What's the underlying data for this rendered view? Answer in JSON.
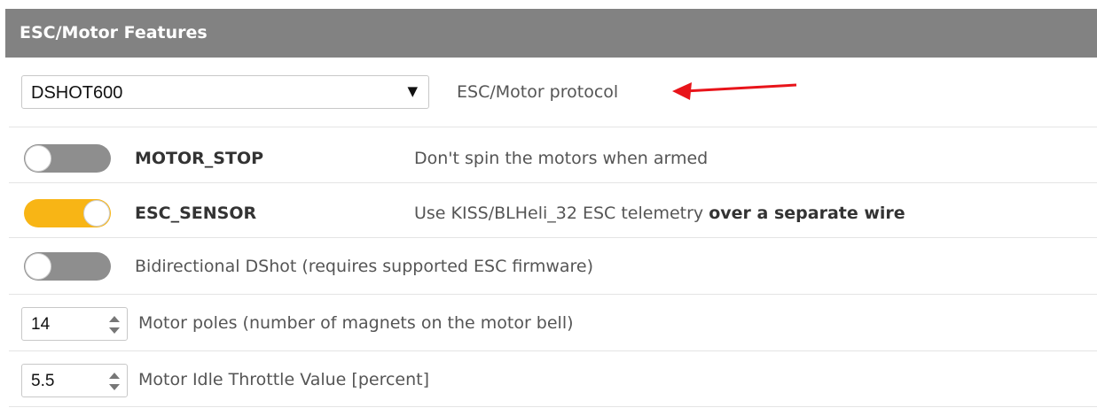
{
  "header": {
    "title": "ESC/Motor Features"
  },
  "protocol": {
    "selected": "DSHOT600",
    "arrow_glyph": "▼",
    "label": "ESC/Motor protocol"
  },
  "features": [
    {
      "name": "MOTOR_STOP",
      "enabled": false,
      "description": "Don't spin the motors when armed"
    },
    {
      "name": "ESC_SENSOR",
      "enabled": true,
      "description_pre": "Use KISS/BLHeli_32 ESC telemetry ",
      "description_bold": "over a separate wire"
    },
    {
      "enabled": false,
      "description": "Bidirectional DShot (requires supported ESC firmware)"
    }
  ],
  "motor_poles": {
    "value": "14",
    "label": "Motor poles (number of magnets on the motor bell)"
  },
  "idle_throttle": {
    "value": "5.5",
    "label": "Motor Idle Throttle Value [percent]"
  },
  "colors": {
    "header_bg": "#828282",
    "toggle_on": "#f8b515",
    "toggle_off": "#8e8e8e",
    "annotation_arrow": "#e8141a"
  }
}
